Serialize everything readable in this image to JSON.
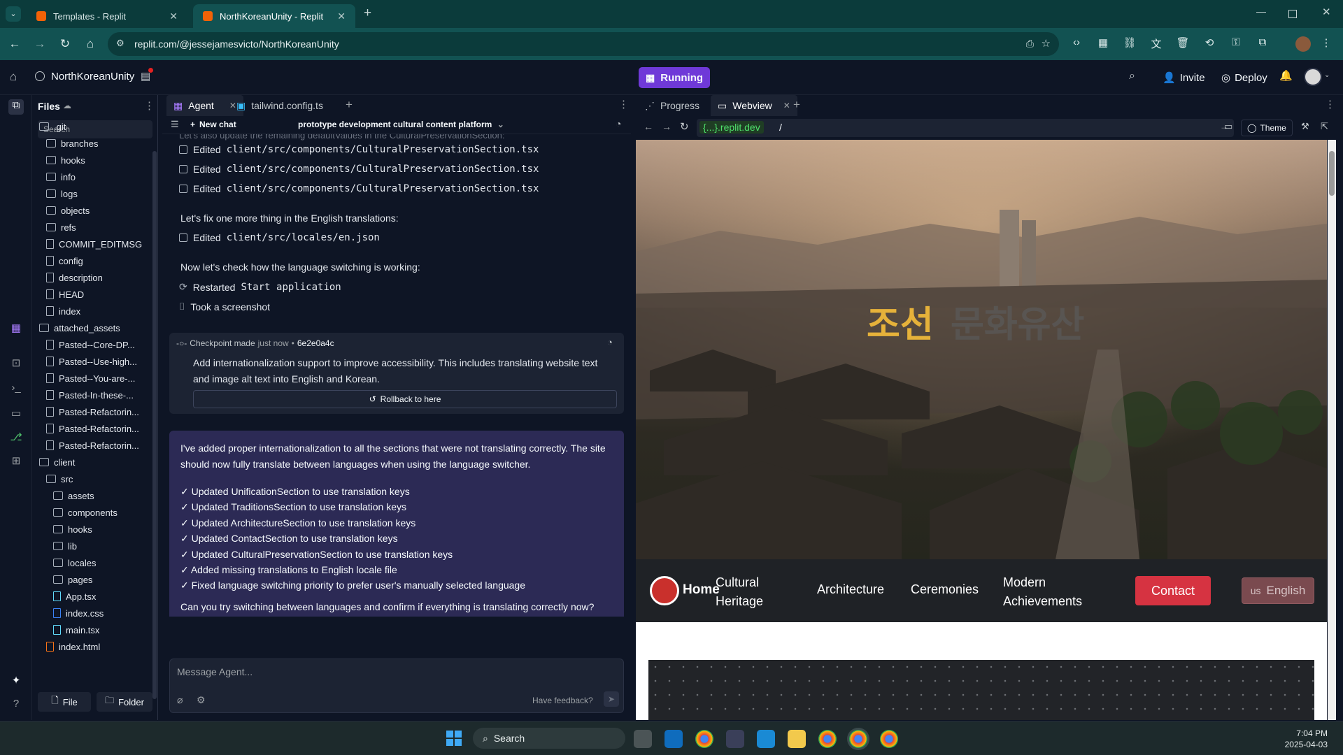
{
  "browser": {
    "tabs": [
      {
        "label": "Templates - Replit",
        "active": false
      },
      {
        "label": "NorthKoreanUnity - Replit",
        "active": true
      }
    ],
    "url": "replit.com/@jessejamesvicto/NorthKoreanUnity"
  },
  "replit": {
    "project_name": "NorthKoreanUnity",
    "run_status": "Running",
    "invite_label": "Invite",
    "deploy_label": "Deploy"
  },
  "files": {
    "title": "Files",
    "search_placeholder": "Search",
    "tree": [
      {
        "name": ".git",
        "type": "folder",
        "depth": 0
      },
      {
        "name": "branches",
        "type": "folder",
        "depth": 1
      },
      {
        "name": "hooks",
        "type": "folder",
        "depth": 1
      },
      {
        "name": "info",
        "type": "folder",
        "depth": 1
      },
      {
        "name": "logs",
        "type": "folder",
        "depth": 1
      },
      {
        "name": "objects",
        "type": "folder",
        "depth": 1
      },
      {
        "name": "refs",
        "type": "folder",
        "depth": 1
      },
      {
        "name": "COMMIT_EDITMSG",
        "type": "file",
        "depth": 1
      },
      {
        "name": "config",
        "type": "file",
        "depth": 1
      },
      {
        "name": "description",
        "type": "file",
        "depth": 1
      },
      {
        "name": "HEAD",
        "type": "file",
        "depth": 1
      },
      {
        "name": "index",
        "type": "file",
        "depth": 1
      },
      {
        "name": "attached_assets",
        "type": "folder",
        "depth": 0
      },
      {
        "name": "Pasted--Core-DP...",
        "type": "file",
        "depth": 1
      },
      {
        "name": "Pasted--Use-high...",
        "type": "file",
        "depth": 1
      },
      {
        "name": "Pasted--You-are-...",
        "type": "file",
        "depth": 1
      },
      {
        "name": "Pasted-In-these-...",
        "type": "file",
        "depth": 1
      },
      {
        "name": "Pasted-Refactorin...",
        "type": "file",
        "depth": 1
      },
      {
        "name": "Pasted-Refactorin...",
        "type": "file",
        "depth": 1
      },
      {
        "name": "Pasted-Refactorin...",
        "type": "file",
        "depth": 1
      },
      {
        "name": "client",
        "type": "folder",
        "depth": 0
      },
      {
        "name": "src",
        "type": "folder",
        "depth": 1
      },
      {
        "name": "assets",
        "type": "folder",
        "depth": 2
      },
      {
        "name": "components",
        "type": "folder",
        "depth": 2
      },
      {
        "name": "hooks",
        "type": "folder",
        "depth": 2
      },
      {
        "name": "lib",
        "type": "folder",
        "depth": 2
      },
      {
        "name": "locales",
        "type": "folder",
        "depth": 2
      },
      {
        "name": "pages",
        "type": "folder",
        "depth": 2
      },
      {
        "name": "App.tsx",
        "type": "react",
        "depth": 2
      },
      {
        "name": "index.css",
        "type": "css",
        "depth": 2
      },
      {
        "name": "main.tsx",
        "type": "react",
        "depth": 2
      },
      {
        "name": "index.html",
        "type": "html",
        "depth": 1
      }
    ],
    "new_file_label": "File",
    "new_folder_label": "Folder"
  },
  "agent": {
    "tabs": [
      {
        "label": "Agent",
        "active": true
      },
      {
        "label": "tailwind.config.ts",
        "active": false
      }
    ],
    "new_chat_label": "New chat",
    "chat_title": "prototype development cultural content platform",
    "edits": [
      {
        "label": "Edited",
        "file": "client/src/components/CulturalPreservationSection.tsx"
      },
      {
        "label": "Edited",
        "file": "client/src/components/CulturalPreservationSection.tsx"
      },
      {
        "label": "Edited",
        "file": "client/src/components/CulturalPreservationSection.tsx"
      }
    ],
    "msg_fix": "Let's fix one more thing in the English translations:",
    "edit_locale": {
      "label": "Edited",
      "file": "client/src/locales/en.json"
    },
    "msg_check": "Now let's check how the language switching is working:",
    "restarted": {
      "label": "Restarted",
      "target": "Start application"
    },
    "screenshot": "Took a screenshot",
    "checkpoint": {
      "label": "Checkpoint made",
      "time": "just now",
      "hash": "6e2e0a4c",
      "description": "Add internationalization support to improve accessibility. This includes translating website text and image alt text into English and Korean.",
      "rollback_label": "Rollback to here"
    },
    "summary": {
      "intro": "I've added proper internationalization to all the sections that were not translating correctly. The site should now fully translate between languages when using the language switcher.",
      "items": [
        "✓ Updated UnificationSection to use translation keys",
        "✓ Updated TraditionsSection to use translation keys",
        "✓ Updated ArchitectureSection to use translation keys",
        "✓ Updated ContactSection to use translation keys",
        "✓ Updated CulturalPreservationSection to use translation keys",
        "✓ Added missing translations to English locale file",
        "✓ Fixed language switching priority to prefer user's manually selected language"
      ],
      "question": "Can you try switching between languages and confirm if everything is translating correctly now?"
    },
    "input_placeholder": "Message Agent...",
    "feedback_label": "Have feedback?"
  },
  "webview": {
    "tabs": [
      {
        "label": "Progress",
        "active": false
      },
      {
        "label": "Webview",
        "active": true
      }
    ],
    "domain": "{...}.replit.dev",
    "path": "/",
    "theme_label": "Theme",
    "hero_title_a": "조선",
    "hero_title_b": "문화유산",
    "site_nav": {
      "home": "Home",
      "links": [
        "Cultural Heritage",
        "Architecture",
        "Ceremonies",
        "Modern Achievements"
      ],
      "contact": "Contact",
      "lang_flag": "us",
      "lang": "English"
    }
  },
  "taskbar": {
    "search_label": "Search",
    "time": "7:04 PM",
    "date": "2025-04-03"
  }
}
